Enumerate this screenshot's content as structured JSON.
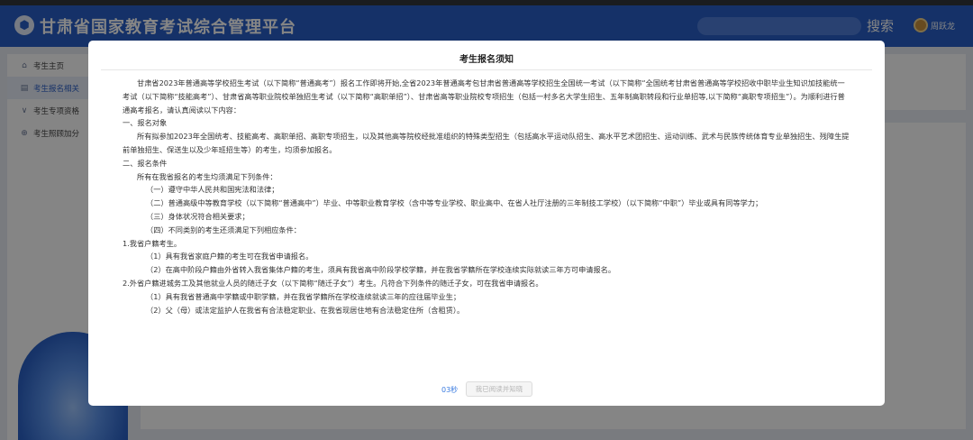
{
  "header": {
    "logo_glyph": "⬢",
    "title": "甘肃省国家教育考试综合管理平台",
    "search_placeholder": "",
    "search_button": "搜索",
    "user_name": "周跃龙"
  },
  "sidebar": {
    "items": [
      {
        "icon": "home-icon",
        "glyph": "⌂",
        "label": "考生主页",
        "active": false
      },
      {
        "icon": "document-icon",
        "glyph": "▤",
        "label": "考生报名相关",
        "active": true
      },
      {
        "icon": "checkmark-icon",
        "glyph": "∨",
        "label": "考生专项资格",
        "active": false
      },
      {
        "icon": "plus-circle-icon",
        "glyph": "⊕",
        "label": "考生照顾加分",
        "active": false
      }
    ]
  },
  "modal": {
    "title": "考生报名须知",
    "paragraphs": [
      "甘肃省2023年普通高等学校招生考试（以下简称“普通高考”）报名工作即将开始,全省2023年普通高考包甘肃省普通高等学校招生全国统一考试（以下简称“全国统考甘肃省普通高等学校招收中职毕业生知识加技能统一考试（以下简称“技能高考”）、甘肃省高等职业院校单独招生考试（以下简称“高职单招”）、甘肃省高等职业院校专项招生（包括一村多名大学生招生、五年制高职转段和行业单招等,以下简称“高职专项招生”）。为顺利进行普通高考报名，请认真阅读以下内容：",
      "一、报名对象",
      "所有拟参加2023年全国统考、技能高考、高职单招、高职专项招生，以及其他高等院校经批准组织的特殊类型招生（包括高水平运动队招生、高水平艺术团招生、运动训练、武术与民族传统体育专业单独招生、残障生提前单独招生、保送生以及少年班招生等）的考生，均须参加报名。",
      "二、报名条件",
      "所有在我省报名的考生均须满足下列条件：",
      "（一）遵守中华人民共和国宪法和法律；",
      "（二）普通高级中等教育学校（以下简称“普通高中”）毕业、中等职业教育学校（含中等专业学校、职业高中、在省人社厅注册的三年制技工学校）（以下简称“中职”）毕业或具有同等学力；",
      "（三）身体状况符合相关要求；",
      "（四）不同类别的考生还须满足下列相应条件：",
      "1.我省户籍考生。",
      "（1）具有我省家庭户籍的考生可在我省申请报名。",
      "（2）在高中阶段户籍由外省转入我省集体户籍的考生，须具有我省高中阶段学校学籍，并在我省学籍所在学校连续实际就读三年方可申请报名。",
      "2.外省户籍进城务工及其他就业人员的随迁子女（以下简称“随迁子女”）考生。凡符合下列条件的随迁子女，可在我省申请报名。",
      "（1）具有我省普通高中学籍或中职学籍，并在我省学籍所在学校连续就读三年的应往届毕业生；",
      "（2）父（母）或法定监护人在我省有合法稳定职业、在我省现居住地有合法稳定住所（含租赁）。"
    ],
    "countdown": "03秒",
    "confirm_button": "我已阅读并知晓"
  },
  "colors": {
    "header_bg": "#2a5fc7",
    "accent": "#3a7be0",
    "overlay": "rgba(0,0,0,0.48)"
  }
}
